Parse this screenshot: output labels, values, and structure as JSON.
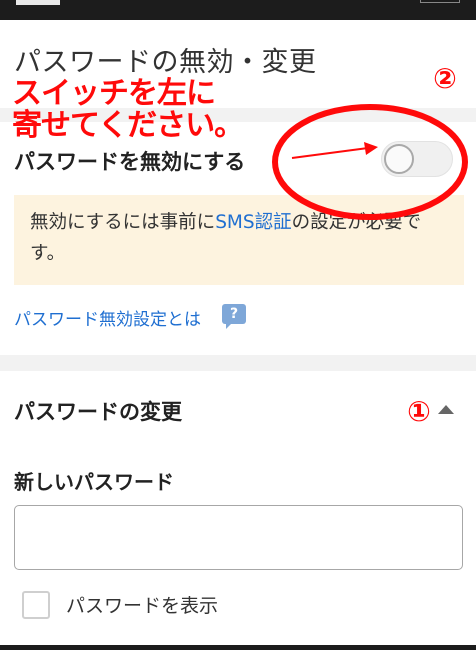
{
  "page": {
    "title": "パスワードの無効・変更"
  },
  "annotation": {
    "instruction_line1": "スイッチを左に",
    "instruction_line2": "寄せてください。",
    "marker_1": "①",
    "marker_2": "②",
    "color": "#ff0a0a"
  },
  "disable_section": {
    "label": "パスワードを無効にする",
    "toggle_on": false,
    "notice_before": "無効にするには事前に",
    "notice_link": "SMS認証",
    "notice_after": "の設定が必要です。",
    "about_link": "パスワード無効設定とは",
    "help_icon_text": "?"
  },
  "change_section": {
    "title": "パスワードの変更",
    "expanded": true,
    "new_password_label": "新しいパスワード",
    "new_password_value": "",
    "show_password_label": "パスワードを表示",
    "show_password_checked": false
  },
  "colors": {
    "link": "#1f6fd1",
    "notice_bg": "#fdf3df",
    "header": "#1c1c1c"
  }
}
